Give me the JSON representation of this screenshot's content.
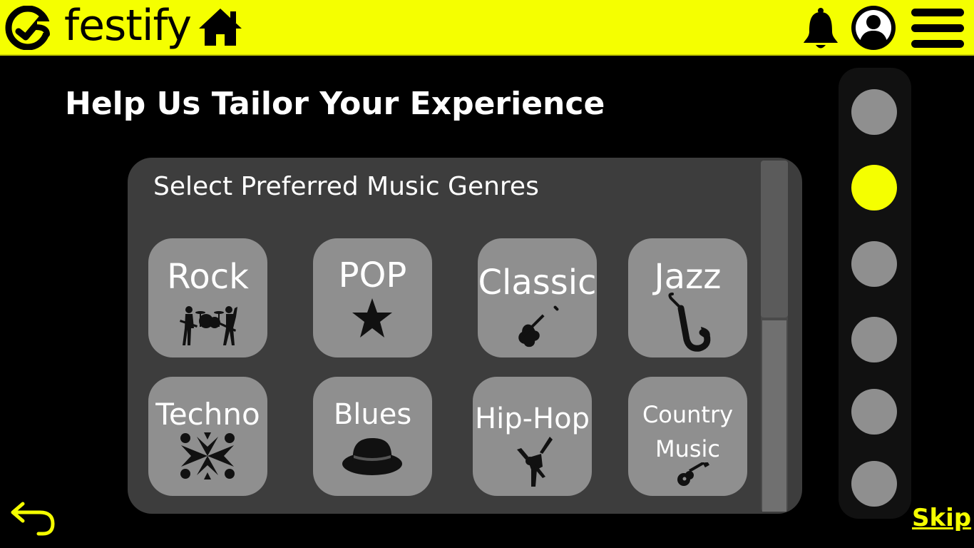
{
  "header": {
    "brand": "festify",
    "icons": [
      "logo-icon",
      "home-icon",
      "bell-icon",
      "user-icon",
      "menu-icon"
    ]
  },
  "page": {
    "title": "Help Us Tailor Your Experience"
  },
  "panel": {
    "subtitle": "Select Preferred Music Genres",
    "genres": [
      {
        "label": "Rock",
        "icon": "rock-band-icon"
      },
      {
        "label": "POP",
        "icon": "star-icon"
      },
      {
        "label": "Classic",
        "icon": "violin-icon"
      },
      {
        "label": "Jazz",
        "icon": "saxophone-icon"
      },
      {
        "label": "Techno",
        "icon": "techno-pattern-icon"
      },
      {
        "label": "Blues",
        "icon": "fedora-hat-icon"
      },
      {
        "label": "Hip-Hop",
        "icon": "breakdancer-icon"
      },
      {
        "label": "Country",
        "label2": "Music",
        "icon": "guitar-icon"
      }
    ]
  },
  "stepper": {
    "total": 6,
    "active_index": 1
  },
  "footer": {
    "skip_label": "Skip",
    "back_icon": "back-arrow-icon"
  },
  "colors": {
    "accent": "#f5ff00",
    "background": "#000000",
    "panel": "#3d3d3d",
    "tile": "#8f8f8f"
  }
}
